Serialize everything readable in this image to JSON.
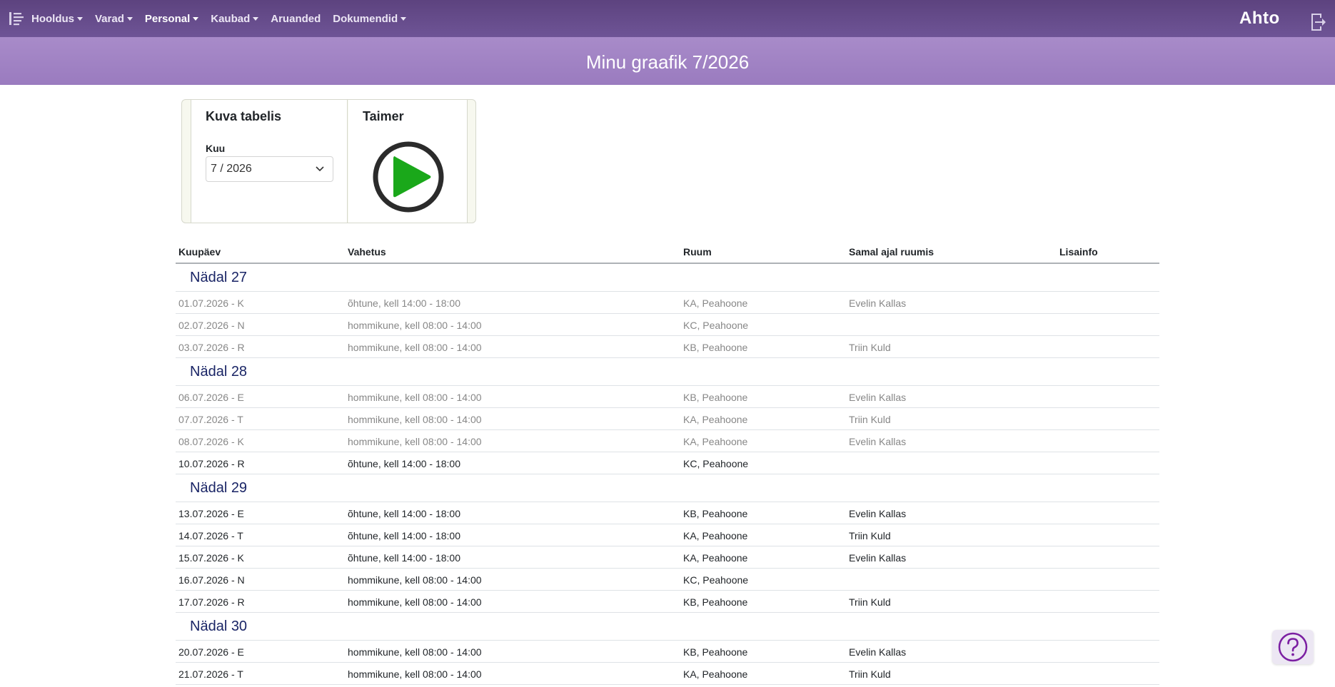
{
  "nav": {
    "brand": "Ahto",
    "items": [
      {
        "label": "Hooldus",
        "dropdown": true,
        "active": false
      },
      {
        "label": "Varad",
        "dropdown": true,
        "active": false
      },
      {
        "label": "Personal",
        "dropdown": true,
        "active": true
      },
      {
        "label": "Kaubad",
        "dropdown": true,
        "active": false
      },
      {
        "label": "Aruanded",
        "dropdown": false,
        "active": false
      },
      {
        "label": "Dokumendid",
        "dropdown": true,
        "active": false
      }
    ]
  },
  "page": {
    "title": "Minu graafik 7/2026"
  },
  "filters": {
    "title": "Kuva tabelis",
    "month_label": "Kuu",
    "month_value": "7 / 2026"
  },
  "timer": {
    "title": "Taimer"
  },
  "table": {
    "headers": [
      "Kuupäev",
      "Vahetus",
      "Ruum",
      "Samal ajal ruumis",
      "Lisainfo"
    ],
    "weeks": [
      {
        "label": "Nädal 27",
        "rows": [
          {
            "date": "01.07.2026 - K",
            "shift": "õhtune, kell 14:00 - 18:00",
            "room": "KA, Peahoone",
            "others": "Evelin Kallas",
            "info": "",
            "past": true
          },
          {
            "date": "02.07.2026 - N",
            "shift": "hommikune, kell 08:00 - 14:00",
            "room": "KC, Peahoone",
            "others": "",
            "info": "",
            "past": true
          },
          {
            "date": "03.07.2026 - R",
            "shift": "hommikune, kell 08:00 - 14:00",
            "room": "KB, Peahoone",
            "others": "Triin Kuld",
            "info": "",
            "past": true
          }
        ]
      },
      {
        "label": "Nädal 28",
        "rows": [
          {
            "date": "06.07.2026 - E",
            "shift": "hommikune, kell 08:00 - 14:00",
            "room": "KB, Peahoone",
            "others": "Evelin Kallas",
            "info": "",
            "past": true
          },
          {
            "date": "07.07.2026 - T",
            "shift": "hommikune, kell 08:00 - 14:00",
            "room": "KA, Peahoone",
            "others": "Triin Kuld",
            "info": "",
            "past": true
          },
          {
            "date": "08.07.2026 - K",
            "shift": "hommikune, kell 08:00 - 14:00",
            "room": "KA, Peahoone",
            "others": "Evelin Kallas",
            "info": "",
            "past": true
          },
          {
            "date": "10.07.2026 - R",
            "shift": "õhtune, kell 14:00 - 18:00",
            "room": "KC, Peahoone",
            "others": "",
            "info": "",
            "past": false
          }
        ]
      },
      {
        "label": "Nädal 29",
        "rows": [
          {
            "date": "13.07.2026 - E",
            "shift": "õhtune, kell 14:00 - 18:00",
            "room": "KB, Peahoone",
            "others": "Evelin Kallas",
            "info": "",
            "past": false
          },
          {
            "date": "14.07.2026 - T",
            "shift": "õhtune, kell 14:00 - 18:00",
            "room": "KA, Peahoone",
            "others": "Triin Kuld",
            "info": "",
            "past": false
          },
          {
            "date": "15.07.2026 - K",
            "shift": "õhtune, kell 14:00 - 18:00",
            "room": "KA, Peahoone",
            "others": "Evelin Kallas",
            "info": "",
            "past": false
          },
          {
            "date": "16.07.2026 - N",
            "shift": "hommikune, kell 08:00 - 14:00",
            "room": "KC, Peahoone",
            "others": "",
            "info": "",
            "past": false
          },
          {
            "date": "17.07.2026 - R",
            "shift": "hommikune, kell 08:00 - 14:00",
            "room": "KB, Peahoone",
            "others": "Triin Kuld",
            "info": "",
            "past": false
          }
        ]
      },
      {
        "label": "Nädal 30",
        "rows": [
          {
            "date": "20.07.2026 - E",
            "shift": "hommikune, kell 08:00 - 14:00",
            "room": "KB, Peahoone",
            "others": "Evelin Kallas",
            "info": "",
            "past": false
          },
          {
            "date": "21.07.2026 - T",
            "shift": "hommikune, kell 08:00 - 14:00",
            "room": "KA, Peahoone",
            "others": "Triin Kuld",
            "info": "",
            "past": false
          }
        ]
      }
    ]
  },
  "icons": {
    "menu_toggle": "menu-toggle-icon",
    "logout": "logout-icon",
    "play": "play-icon",
    "help": "help-icon",
    "chevron": "chevron-down-icon"
  },
  "colors": {
    "navbar": "#5d437f",
    "title_band": "#a88bc9",
    "play_green": "#1aa81a",
    "week_label": "#1a2566",
    "help_icon": "#7b1fa2"
  }
}
